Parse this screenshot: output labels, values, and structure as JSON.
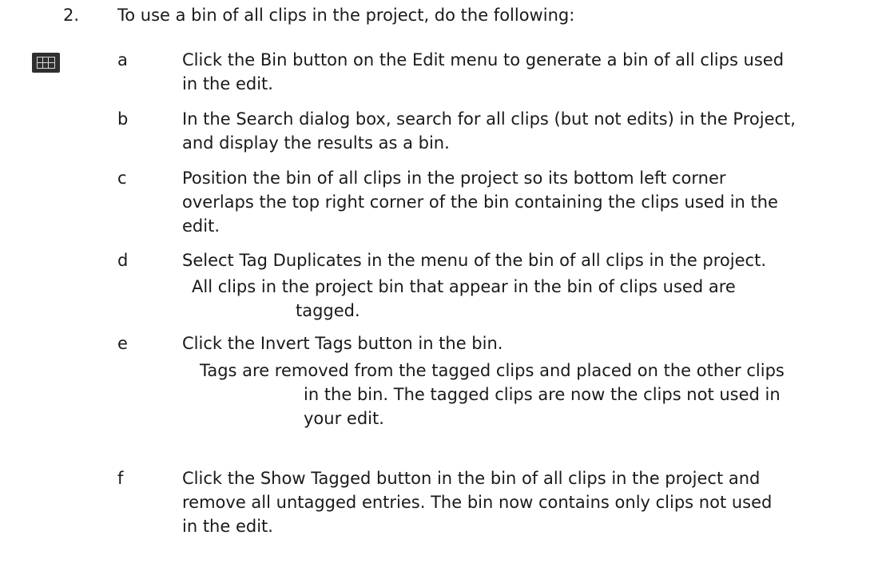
{
  "step": {
    "number": "2.",
    "text": "To use a bin of all clips in the project, do the following:"
  },
  "margin_icon": "bin-button-icon",
  "substeps": [
    {
      "letter": "a",
      "lines": [
        "Click the Bin button on the Edit menu to generate a bin of all clips used",
        "in the edit."
      ]
    },
    {
      "letter": "b",
      "lines": [
        "In the Search dialog box, search for all clips (but not edits) in the Project,",
        "and display the results as a bin."
      ]
    },
    {
      "letter": "c",
      "lines": [
        "Position the bin of all clips in the project so its bottom left corner",
        "overlaps the top right corner of the bin containing the clips used in the",
        "edit."
      ]
    },
    {
      "letter": "d",
      "lines": [
        "Select Tag Duplicates in the menu of the bin of all clips in the project."
      ],
      "result": [
        "All clips in the project bin that appear in the bin of clips used are",
        "tagged."
      ]
    },
    {
      "letter": "e",
      "lines": [
        "Click the Invert Tags button in the bin."
      ],
      "result": [
        "Tags are removed from the tagged clips and placed on the other clips",
        "in the bin. The tagged clips are now the clips not used in",
        "your edit."
      ]
    },
    {
      "letter": "f",
      "lines": [
        "Click the Show Tagged button in the bin of all clips in the project and",
        "remove all untagged entries. The bin now contains only clips not used",
        "in the edit."
      ]
    }
  ]
}
